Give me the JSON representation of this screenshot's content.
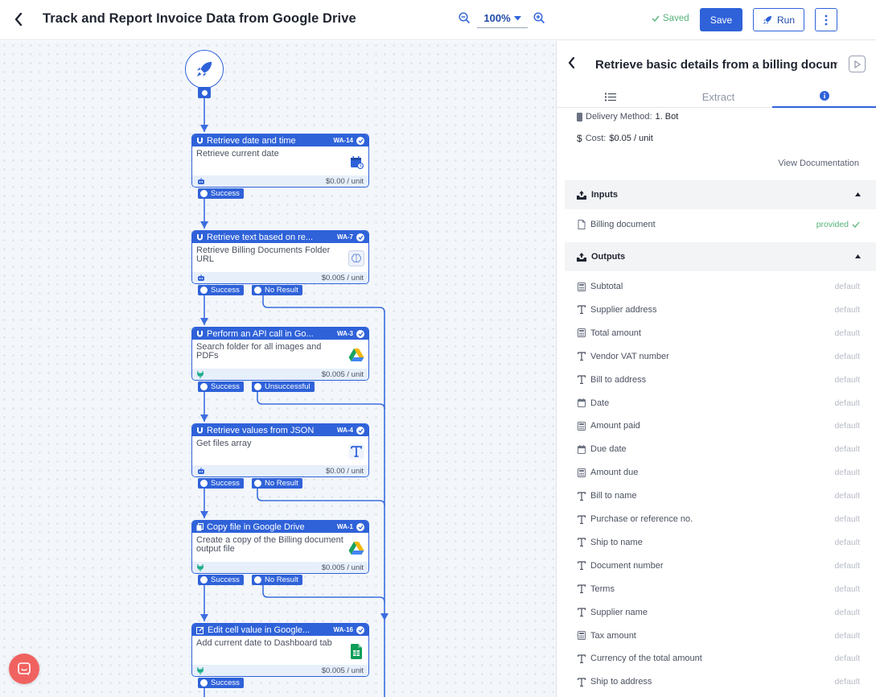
{
  "header": {
    "title": "Track and Report Invoice Data from Google Drive",
    "zoom": "100%",
    "saved_label": "Saved",
    "save_label": "Save",
    "run_label": "Run"
  },
  "flow": {
    "nodes": [
      {
        "title": "Retrieve date and time",
        "code": "WA-14",
        "description": "Retrieve current date",
        "cost": "$0.00 / unit",
        "app_icon": "calendar-icon"
      },
      {
        "title": "Retrieve text based on re...",
        "code": "WA-7",
        "description": "Retrieve Billing Documents Folder URL",
        "cost": "$0.005 / unit",
        "app_icon": "brain-icon"
      },
      {
        "title": "Perform an API call in Go...",
        "code": "WA-3",
        "description": "Search folder for all images and PDFs",
        "cost": "$0.005 / unit",
        "app_icon": "google-drive-icon"
      },
      {
        "title": "Retrieve values from JSON",
        "code": "WA-4",
        "description": "Get files array",
        "cost": "$0.00 / unit",
        "app_icon": "text-icon"
      },
      {
        "title": "Copy file in Google Drive",
        "code": "WA-1",
        "description": "Create a copy of the Billing document output file",
        "cost": "$0.005 / unit",
        "app_icon": "google-drive-icon"
      },
      {
        "title": "Edit cell value in Google...",
        "code": "WA-16",
        "description": "Add current date to Dashboard tab",
        "cost": "$0.005 / unit",
        "app_icon": "google-sheets-icon"
      }
    ],
    "ports": {
      "success": "Success",
      "no_result": "No Result",
      "unsuccessful": "Unsuccessful"
    }
  },
  "panel": {
    "title": "Retrieve basic details from a billing document",
    "tabs": {
      "extract": "Extract"
    },
    "delivery_label": "Delivery Method:",
    "delivery_value": "1. Bot",
    "cost_label": "Cost:",
    "cost_value": "$0.05 / unit",
    "view_doc": "View Documentation",
    "inputs_header": "Inputs",
    "inputs": [
      {
        "label": "Billing document",
        "value": "provided"
      }
    ],
    "outputs_header": "Outputs",
    "outputs": [
      {
        "label": "Subtotal",
        "value": "default",
        "icon": "number-icon"
      },
      {
        "label": "Supplier address",
        "value": "default",
        "icon": "text-icon"
      },
      {
        "label": "Total amount",
        "value": "default",
        "icon": "number-icon"
      },
      {
        "label": "Vendor VAT number",
        "value": "default",
        "icon": "text-icon"
      },
      {
        "label": "Bill to address",
        "value": "default",
        "icon": "text-icon"
      },
      {
        "label": "Date",
        "value": "default",
        "icon": "calendar-icon"
      },
      {
        "label": "Amount paid",
        "value": "default",
        "icon": "number-icon"
      },
      {
        "label": "Due date",
        "value": "default",
        "icon": "calendar-icon"
      },
      {
        "label": "Amount due",
        "value": "default",
        "icon": "number-icon"
      },
      {
        "label": "Bill to name",
        "value": "default",
        "icon": "text-icon"
      },
      {
        "label": "Purchase or reference no.",
        "value": "default",
        "icon": "text-icon"
      },
      {
        "label": "Ship to name",
        "value": "default",
        "icon": "text-icon"
      },
      {
        "label": "Document number",
        "value": "default",
        "icon": "text-icon"
      },
      {
        "label": "Terms",
        "value": "default",
        "icon": "text-icon"
      },
      {
        "label": "Supplier name",
        "value": "default",
        "icon": "text-icon"
      },
      {
        "label": "Tax amount",
        "value": "default",
        "icon": "number-icon"
      },
      {
        "label": "Currency of the total amount",
        "value": "default",
        "icon": "text-icon"
      },
      {
        "label": "Ship to address",
        "value": "default",
        "icon": "text-icon"
      }
    ]
  },
  "colors": {
    "accent": "#2f62d9",
    "success_text": "#56b37a",
    "chat": "#f06260"
  }
}
